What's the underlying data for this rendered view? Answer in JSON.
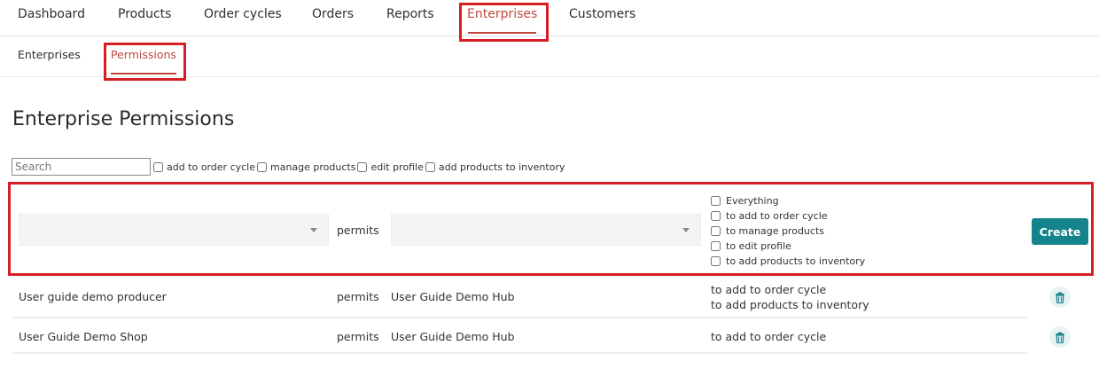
{
  "topnav": {
    "items": [
      "Dashboard",
      "Products",
      "Order cycles",
      "Orders",
      "Reports",
      "Enterprises",
      "Customers"
    ],
    "active": "Enterprises"
  },
  "subnav": {
    "items": [
      "Enterprises",
      "Permissions"
    ],
    "active": "Permissions"
  },
  "page_title": "Enterprise Permissions",
  "filters": {
    "search_placeholder": "Search",
    "options": [
      "add to order cycle",
      "manage products",
      "edit profile",
      "add products to inventory"
    ]
  },
  "new_permission": {
    "permits_label": "permits",
    "options": [
      "Everything",
      "to add to order cycle",
      "to manage products",
      "to edit profile",
      "to add products to inventory"
    ],
    "create_label": "Create"
  },
  "rows": [
    {
      "enterprise": "User guide demo producer",
      "permits": "permits",
      "target": "User Guide Demo Hub",
      "permissions": [
        "to add to order cycle",
        "to add products to inventory"
      ]
    },
    {
      "enterprise": "User Guide Demo Shop",
      "permits": "permits",
      "target": "User Guide Demo Hub",
      "permissions": [
        "to add to order cycle"
      ]
    }
  ],
  "colors": {
    "accent": "#c1473e",
    "highlight": "#d61e24",
    "button": "#14838b"
  }
}
